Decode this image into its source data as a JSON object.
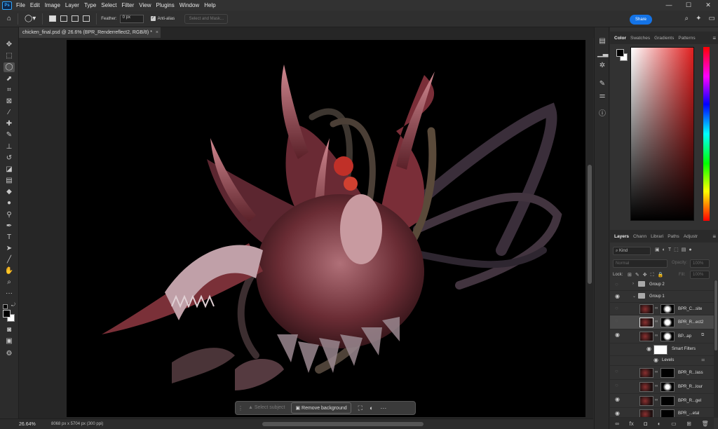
{
  "menu": {
    "items": [
      "File",
      "Edit",
      "Image",
      "Layer",
      "Type",
      "Select",
      "Filter",
      "View",
      "Plugins",
      "Window",
      "Help"
    ]
  },
  "window_controls": [
    "—",
    "☐",
    "✕"
  ],
  "options": {
    "feather_label": "Feather:",
    "feather_value": "0 px",
    "antialias_label": "Anti-alias",
    "select_mask_label": "Select and Mask...",
    "share_label": "Share"
  },
  "document": {
    "tab_title": "chicken_final.psd @ 26.6% (BPR_Renderreflect2, RGB/8) *",
    "close": "×"
  },
  "status": {
    "zoom": "26.64%",
    "dimensions": "8068 px x 5704 px (300 ppi)"
  },
  "contextual_bar": {
    "select_subject": "Select subject",
    "remove_background": "Remove background"
  },
  "color_panel": {
    "tabs": [
      "Color",
      "Swatches",
      "Gradients",
      "Patterns"
    ]
  },
  "layers_panel": {
    "tabs": [
      "Layers",
      "Chann",
      "Librari",
      "Paths",
      "Adjustr"
    ],
    "filter_kind": "Kind",
    "blend_mode": "Normal",
    "opacity_label": "Opacity:",
    "opacity_value": "100%",
    "lock_label": "Lock:",
    "fill_label": "Fill:",
    "fill_value": "100%",
    "layers": [
      {
        "name": "Group 2"
      },
      {
        "name": "Group 1"
      },
      {
        "name": "BPR_C...site"
      },
      {
        "name": "BPR_R...ect2"
      },
      {
        "name": "BP...ap"
      },
      {
        "name": "Smart Filters"
      },
      {
        "name": "Levels"
      },
      {
        "name": "BPR_R...lass"
      },
      {
        "name": "BPR_R...lour"
      },
      {
        "name": "BPR_R...gel"
      },
      {
        "name": "BPR_...etal"
      }
    ]
  }
}
